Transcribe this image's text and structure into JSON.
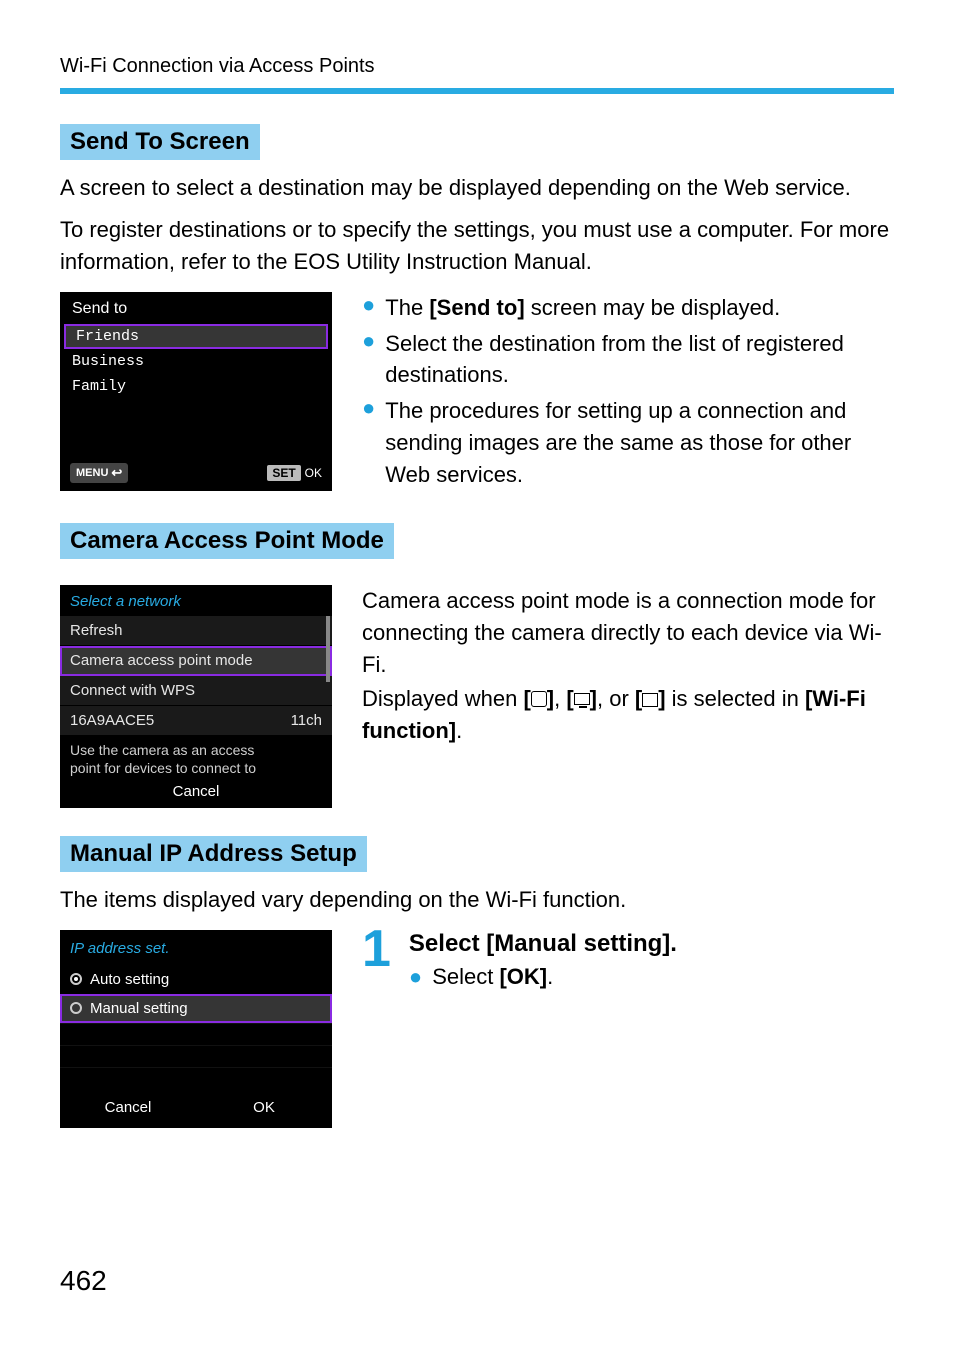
{
  "page_header": "Wi-Fi Connection via Access Points",
  "page_number": "462",
  "section1": {
    "heading": "Send To Screen",
    "para1": "A screen to select a destination may be displayed depending on the Web service.",
    "para2": "To register destinations or to specify the settings, you must use a computer. For more information, refer to the EOS Utility Instruction Manual.",
    "camera": {
      "title": "Send to",
      "items": [
        "Friends",
        "Business",
        "Family"
      ],
      "menu_label": "MENU",
      "set_label": "SET",
      "ok_label": "OK"
    },
    "bullets": {
      "b1_pre": "The ",
      "b1_bold": "[Send to]",
      "b1_post": " screen may be displayed.",
      "b2": "Select the destination from the list of registered destinations.",
      "b3": "The procedures for setting up a connection and sending images are the same as those for other Web services."
    }
  },
  "section2": {
    "heading": "Camera Access Point Mode",
    "camera": {
      "title": "Select a network",
      "items": [
        {
          "label": "Refresh",
          "right": ""
        },
        {
          "label": "Camera access point mode",
          "right": ""
        },
        {
          "label": "Connect with WPS",
          "right": ""
        },
        {
          "label": "16A9AACE5",
          "right": "11ch"
        }
      ],
      "help_l1": "Use the camera as an access",
      "help_l2": "point for devices to connect to",
      "cancel": "Cancel"
    },
    "para1": "Camera access point mode is a connection mode for connecting the camera directly to each device via Wi-Fi.",
    "para2_pre": "Displayed when ",
    "para2_mid": ", or ",
    "para2_post": " is selected in ",
    "para2_bold": "[Wi-Fi function]",
    "para2_end": "."
  },
  "section3": {
    "heading": "Manual IP Address Setup",
    "para": "The items displayed vary depending on the Wi-Fi function.",
    "camera": {
      "title": "IP address set.",
      "auto": "Auto setting",
      "manual": "Manual setting",
      "cancel": "Cancel",
      "ok": "OK"
    },
    "step_number": "1",
    "step_title": "Select [Manual setting].",
    "step_sub_pre": "Select ",
    "step_sub_bold": "[OK]",
    "step_sub_end": "."
  }
}
